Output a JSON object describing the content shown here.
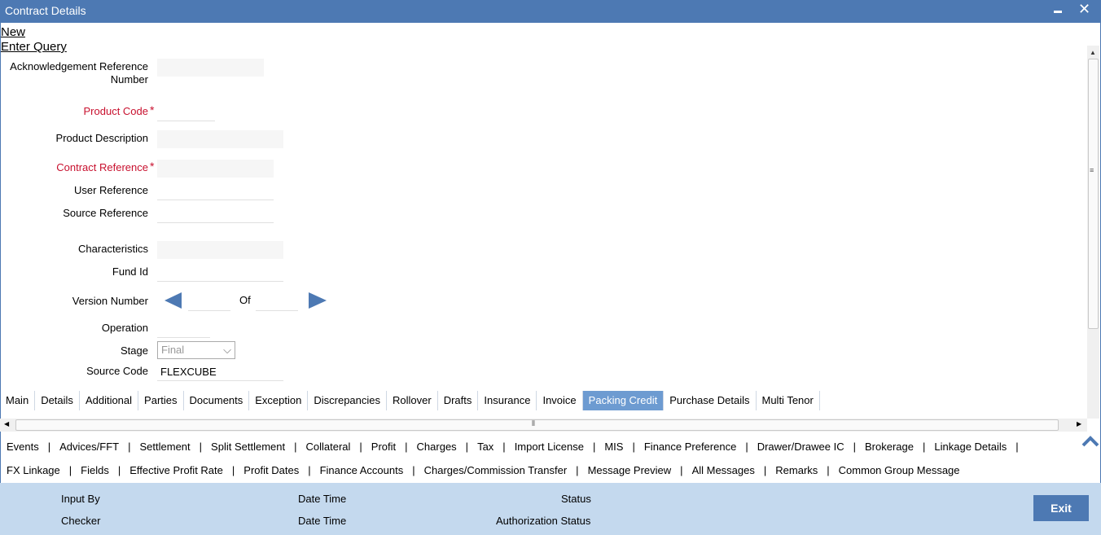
{
  "window": {
    "title": "Contract Details"
  },
  "links": {
    "new": "New",
    "enter_query": "Enter Query"
  },
  "form": {
    "ack_ref_label": "Acknowledgement Reference Number",
    "product_code_label": "Product Code",
    "product_desc_label": "Product Description",
    "contract_ref_label": "Contract Reference",
    "user_ref_label": "User Reference",
    "source_ref_label": "Source Reference",
    "characteristics_label": "Characteristics",
    "fund_id_label": "Fund Id",
    "version_label": "Version Number",
    "of_label": "Of",
    "operation_label": "Operation",
    "stage_label": "Stage",
    "stage_value": "Final",
    "source_code_label": "Source Code",
    "source_code_value": "FLEXCUBE",
    "required_mark": "*"
  },
  "tabs": [
    "Main",
    "Details",
    "Additional",
    "Parties",
    "Documents",
    "Exception",
    "Discrepancies",
    "Rollover",
    "Drafts",
    "Insurance",
    "Invoice",
    "Packing Credit",
    "Purchase Details",
    "Multi Tenor"
  ],
  "active_tab": "Packing Credit",
  "subscreens_row1": [
    "Events",
    "Advices/FFT",
    "Settlement",
    "Split Settlement",
    "Collateral",
    "Profit",
    "Charges",
    "Tax",
    "Import License",
    "MIS",
    "Finance Preference",
    "Drawer/Drawee IC",
    "Brokerage",
    "Linkage Details"
  ],
  "subscreens_row2": [
    "FX Linkage",
    "Fields",
    "Effective Profit Rate",
    "Profit Dates",
    "Finance Accounts",
    "Charges/Commission Transfer",
    "Message Preview",
    "All Messages",
    "Remarks",
    "Common Group Message"
  ],
  "separator": "|",
  "footer": {
    "input_by": "Input By",
    "checker": "Checker",
    "date_time_1": "Date Time",
    "date_time_2": "Date Time",
    "status": "Status",
    "auth_status": "Authorization Status",
    "exit": "Exit"
  },
  "colors": {
    "titlebar": "#4d79b3",
    "active_tab": "#6d9bd1",
    "footer": "#c4d9ee",
    "required": "#c8102e"
  }
}
